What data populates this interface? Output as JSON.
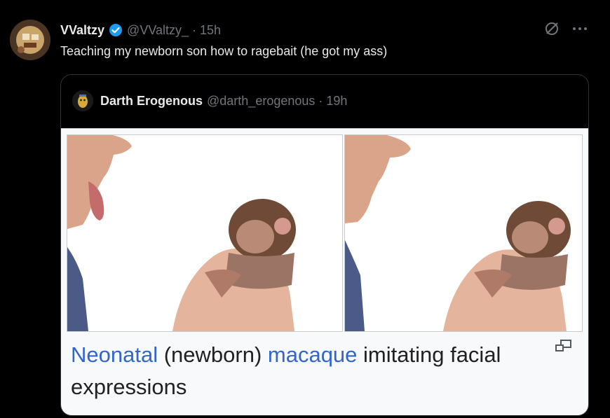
{
  "tweet": {
    "author_name": "VValtzy",
    "author_meta": "@VValtzy_ · 15h",
    "text": "Teaching my newborn son how to ragebait (he got my ass)"
  },
  "quote": {
    "author_name": "Darth Erogenous",
    "author_meta": "@darth_erogenous · 19h",
    "caption": {
      "part1": "Neonatal",
      "part2": " (newborn) ",
      "part3": "macaque",
      "part4": " imitating facial expressions"
    }
  },
  "icons": {
    "verified": "verified-badge-icon",
    "grok": "grok-icon",
    "more": "more-options-icon",
    "enlarge": "enlarge-icon"
  },
  "colors": {
    "background": "#000000",
    "primary_text": "#e7e9ea",
    "secondary_text": "#71767b",
    "verified_blue": "#1d9bf0",
    "wiki_link": "#3366cc"
  }
}
